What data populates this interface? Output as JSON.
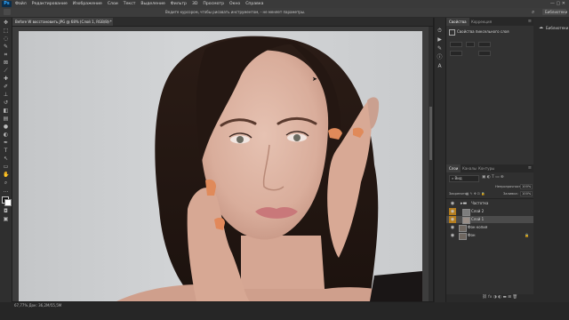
{
  "app": {
    "logo": "Ps"
  },
  "menu": [
    "Файл",
    "Редактирование",
    "Изображение",
    "Слои",
    "Текст",
    "Выделение",
    "Фильтр",
    "3D",
    "Просмотр",
    "Окно",
    "Справка"
  ],
  "options_hint": "Ведите курсором, чтобы рисовать инструментом, - не меняет параметры.",
  "workspace": "Библиотеки",
  "document_tab": {
    "title": "Before W восстановить.JPG @ 68% (Слой 1, RGB/8) *",
    "close": "×"
  },
  "status": "67,77%   Док: 36,2M/55,5M",
  "icons": {
    "theme": "dark",
    "accent": "#31a8ff",
    "selection": "#4b4b4b"
  },
  "properties_panel": {
    "tabs": [
      "Свойства",
      "Коррекция"
    ],
    "subtitle": "Свойства пиксельного слоя"
  },
  "layers_panel": {
    "tabs": [
      "Слои",
      "Каналы",
      "Контуры"
    ],
    "kind_label": "Вид",
    "opacity_label": "Непрозрачность:",
    "opacity_value": "100%",
    "lock_label": "Закрепить:",
    "fill_label": "Заливка:",
    "fill_value": "100%",
    "layers": [
      {
        "name": "Частотка",
        "type": "group"
      },
      {
        "name": "Слой 2",
        "type": "layer",
        "highlight": "#b47d1e"
      },
      {
        "name": "Слой 1",
        "type": "layer",
        "selected": true
      },
      {
        "name": "Фон копия",
        "type": "layer"
      },
      {
        "name": "Фон",
        "type": "layer",
        "locked": true
      }
    ]
  }
}
